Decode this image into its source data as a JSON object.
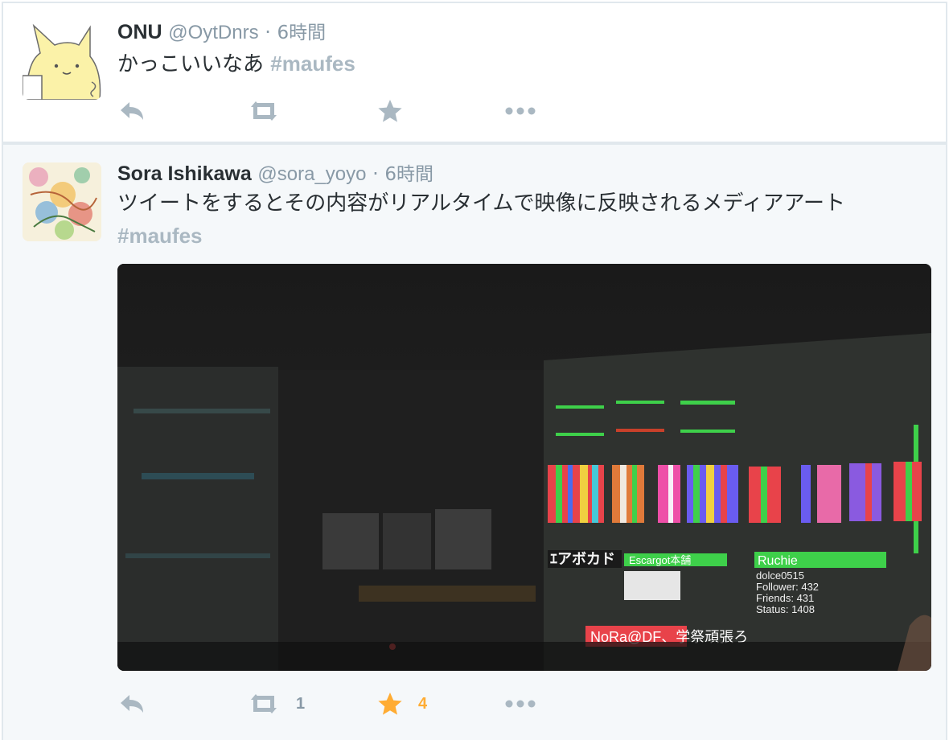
{
  "tweets": [
    {
      "fullname": "ONU",
      "username": "@OytDnrs",
      "separator": "·",
      "time": "6時間",
      "text": "かっこいいなあ",
      "hashtag": "#maufes",
      "retweet_count": "",
      "favorite_count": ""
    },
    {
      "fullname": "Sora Ishikawa",
      "username": "@sora_yoyo",
      "separator": "·",
      "time": "6時間",
      "text": "ツイートをするとその内容がリアルタイムで映像に反映されるメディアアート",
      "hashtag": "#maufes",
      "retweet_count": "1",
      "favorite_count": "4",
      "photo": {
        "labels": [
          "ｴアボカド",
          "Escargot本舗",
          "Ruchie",
          "dolce0515",
          "Follower: 432",
          "Friends: 431",
          "Status: 1408",
          "NoRa@DF、学祭頑張ろ"
        ]
      }
    }
  ],
  "colors": {
    "text": "#292f33",
    "muted": "#8899a6",
    "hashtag": "#aab8c2",
    "favorite_active": "#ffac33",
    "border": "#e1e8ed",
    "selected_bg": "#f5f8fa"
  },
  "icons": [
    "reply-icon",
    "retweet-icon",
    "star-icon",
    "more-icon"
  ]
}
